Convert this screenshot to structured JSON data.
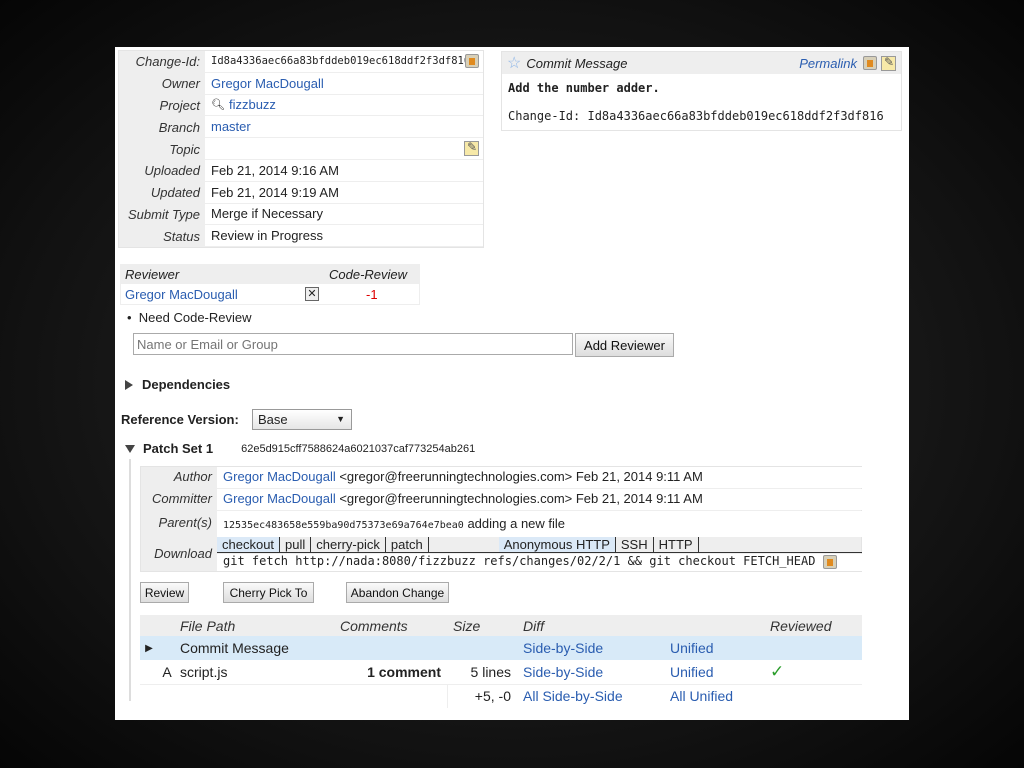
{
  "info": {
    "rows": [
      {
        "label": "Change-Id:",
        "value": "Id8a4336aec66a83bfddeb019ec618ddf2f3df816",
        "type": "mono"
      },
      {
        "label": "Owner",
        "value": "Gregor MacDougall",
        "type": "link"
      },
      {
        "label": "Project",
        "value": "fizzbuzz",
        "type": "link"
      },
      {
        "label": "Branch",
        "value": "master",
        "type": "link"
      },
      {
        "label": "Topic",
        "value": "",
        "type": "text"
      },
      {
        "label": "Uploaded",
        "value": "Feb 21, 2014 9:16 AM",
        "type": "text"
      },
      {
        "label": "Updated",
        "value": "Feb 21, 2014 9:19 AM",
        "type": "text"
      },
      {
        "label": "Submit Type",
        "value": "Merge if Necessary",
        "type": "text"
      },
      {
        "label": "Status",
        "value": "Review in Progress",
        "type": "text"
      }
    ]
  },
  "commit": {
    "title": "Commit Message",
    "permalink": "Permalink",
    "subject": "Add the number adder.",
    "change_id_line": "Change-Id: Id8a4336aec66a83bfddeb019ec618ddf2f3df816"
  },
  "reviewers": {
    "col_reviewer": "Reviewer",
    "col_code_review": "Code-Review",
    "name": "Gregor MacDougall",
    "score": "-1",
    "need": "Need Code-Review",
    "placeholder": "Name or Email or Group",
    "add_button": "Add Reviewer"
  },
  "dependencies": "Dependencies",
  "reference": {
    "label": "Reference Version:",
    "selected": "Base"
  },
  "patchset": {
    "title": "Patch Set 1",
    "hash": "62e5d915cff7588624a6021037caf773254ab261",
    "author_label": "Author",
    "author_name": "Gregor MacDougall",
    "author_rest": "<gregor@freerunningtechnologies.com> Feb 21, 2014 9:11 AM",
    "committer_label": "Committer",
    "committer_name": "Gregor MacDougall",
    "committer_rest": "<gregor@freerunningtechnologies.com> Feb 21, 2014 9:11 AM",
    "parent_label": "Parent(s)",
    "parent_hash": "12535ec483658e559ba90d75373e69a764e7bea0",
    "parent_msg": "adding a new file",
    "download_label": "Download",
    "download_tabs": [
      "checkout",
      "pull",
      "cherry-pick",
      "patch"
    ],
    "protocol_tabs": [
      "Anonymous HTTP",
      "SSH",
      "HTTP"
    ],
    "command": "git fetch http://nada:8080/fizzbuzz refs/changes/02/2/1 && git checkout FETCH_HEAD"
  },
  "actions": {
    "review": "Review",
    "cherry_pick": "Cherry Pick To",
    "abandon": "Abandon Change"
  },
  "files": {
    "headers": [
      "File Path",
      "Comments",
      "Size",
      "Diff",
      "",
      "Reviewed"
    ],
    "rows": [
      {
        "status": "",
        "path": "Commit Message",
        "comments": "",
        "size": "",
        "sbs": "Side-by-Side",
        "unified": "Unified",
        "reviewed": ""
      },
      {
        "status": "A",
        "path": "script.js",
        "comments": "1 comment",
        "size": "5 lines",
        "sbs": "Side-by-Side",
        "unified": "Unified",
        "reviewed": "✓"
      }
    ],
    "total_size": "+5, -0",
    "all_sbs": "All Side-by-Side",
    "all_unified": "All Unified"
  }
}
